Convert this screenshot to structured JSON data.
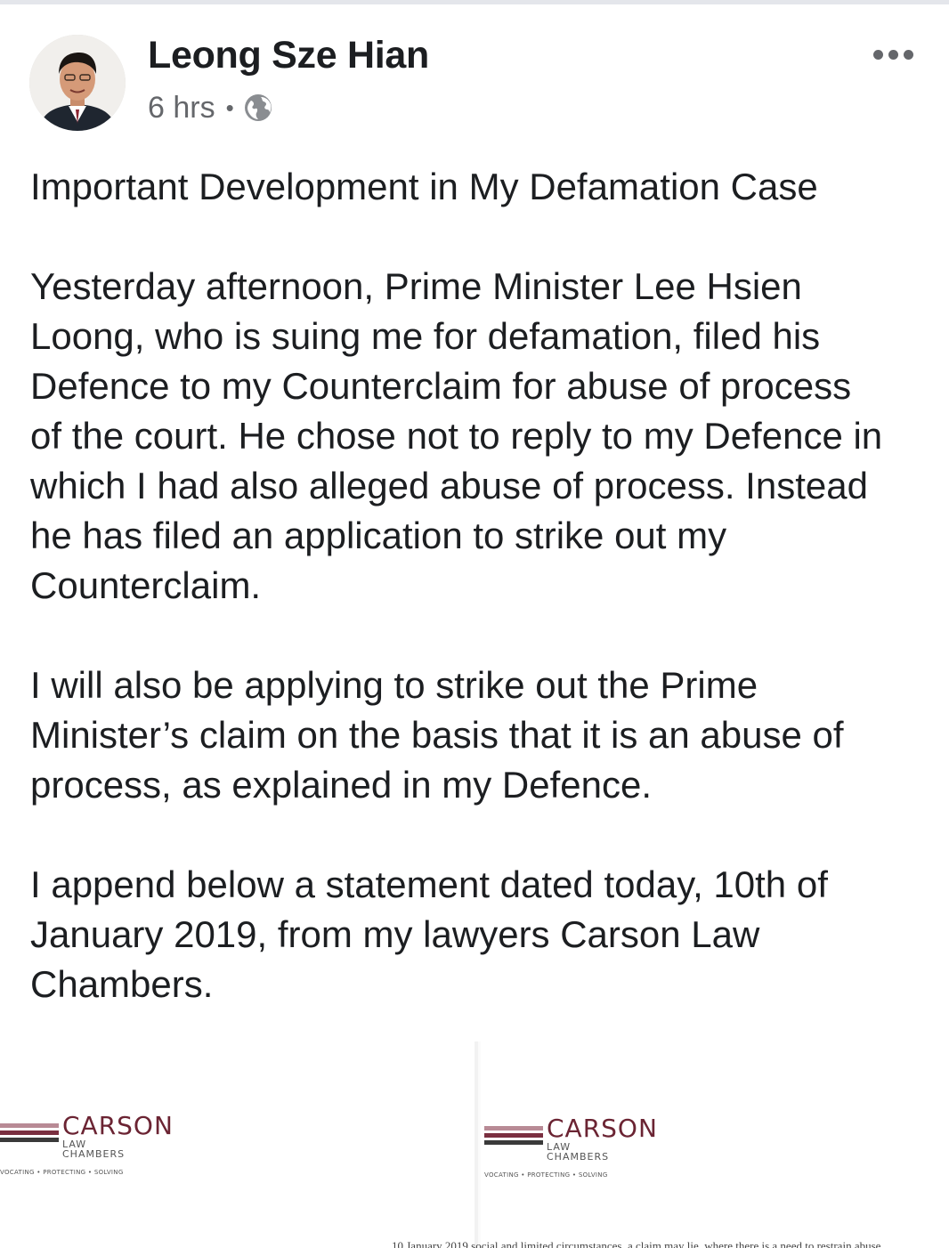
{
  "post": {
    "author": "Leong Sze Hian",
    "timestamp": "6 hrs",
    "separator": "•",
    "privacy_icon": "globe-icon",
    "more_icon": "more-options-icon",
    "paragraphs": [
      "Important Development in My Defamation Case",
      "Yesterday afternoon, Prime Minister Lee Hsien\nLoong, who is suing me for defamation, filed his\nDefence to my Counterclaim for abuse of process\nof the court. He chose not to reply to my Defence in\nwhich I had also alleged abuse of process. Instead\nhe has filed an application to strike out my\nCounterclaim.",
      "I will also be applying to strike out the Prime\nMinister’s claim on the basis that it is an abuse of\nprocess, as explained in my Defence.",
      "I append below a statement dated today, 10th of\nJanuary 2019, from my lawyers Carson Law\nChambers."
    ]
  },
  "attachments": [
    {
      "logo_name": "CARSON",
      "logo_line1": "LAW",
      "logo_line2": "CHAMBERS",
      "tagline": "VOCATING • PROTECTING • SOLVING"
    },
    {
      "logo_name": "CARSON",
      "logo_line1": "LAW",
      "logo_line2": "CHAMBERS",
      "tagline": "VOCATING • PROTECTING • SOLVING",
      "text_line": "10 January 2019   social and limited circumstances, a claim may lie, where there is a need to restrain abuse"
    }
  ],
  "colors": {
    "logo_stripe_light": "#b88a95",
    "logo_stripe_mid": "#7a2f40",
    "logo_stripe_dark": "#3a3a3a"
  }
}
